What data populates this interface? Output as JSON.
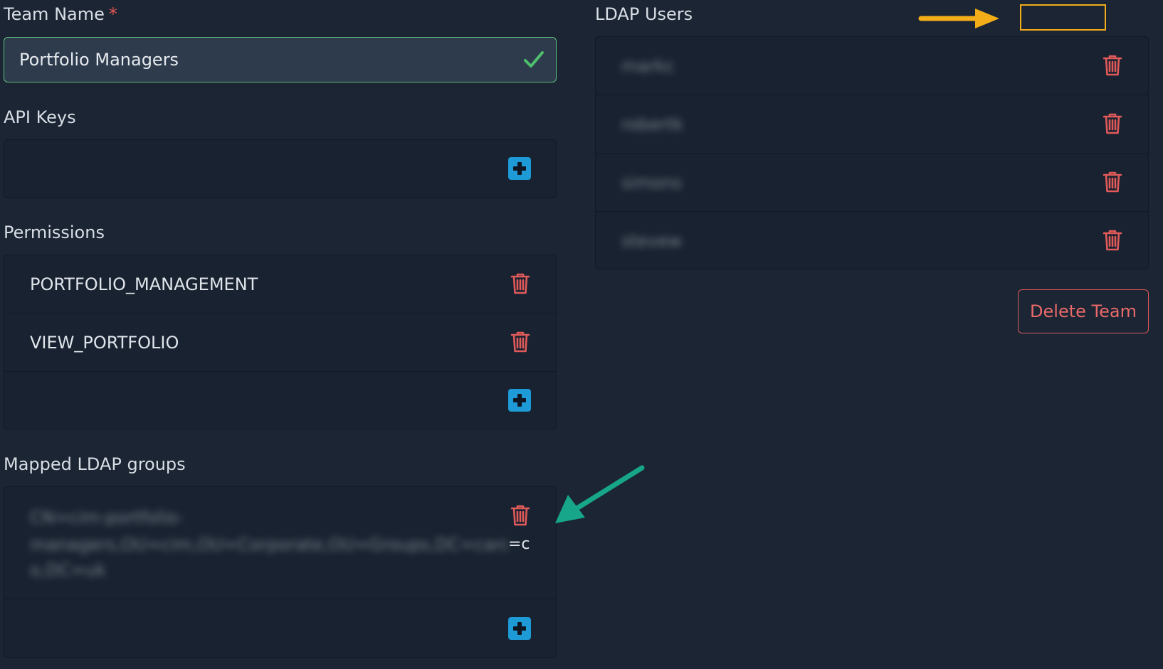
{
  "team_name": {
    "label": "Team Name",
    "required_mark": "*",
    "value": "Portfolio Managers"
  },
  "api_keys": {
    "label": "API Keys"
  },
  "permissions": {
    "label": "Permissions",
    "items": [
      "PORTFOLIO_MANAGEMENT",
      "VIEW_PORTFOLIO"
    ]
  },
  "mapped_ldap_groups": {
    "label": "Mapped LDAP groups",
    "items": [
      {
        "line1": "CN=cim-portfolio-",
        "line2": "managers,OU=cim,OU=Corporate,OU=Groups,DC=card,DC",
        "line2_visible_tail": "=c",
        "line3": "o,DC=uk"
      }
    ]
  },
  "ldap_users": {
    "label": "LDAP Users",
    "items": [
      "markc",
      "robertk",
      "simons",
      "stevew"
    ]
  },
  "actions": {
    "delete_team": "Delete Team"
  },
  "colors": {
    "background": "#1b2533",
    "panel": "#182230",
    "input_bg": "#2d3b4c",
    "valid_border": "#5fbf7a",
    "danger": "#e05a5a",
    "add_button": "#1e9ad6",
    "annotation_orange": "#f2ad18",
    "annotation_teal": "#17a689"
  }
}
